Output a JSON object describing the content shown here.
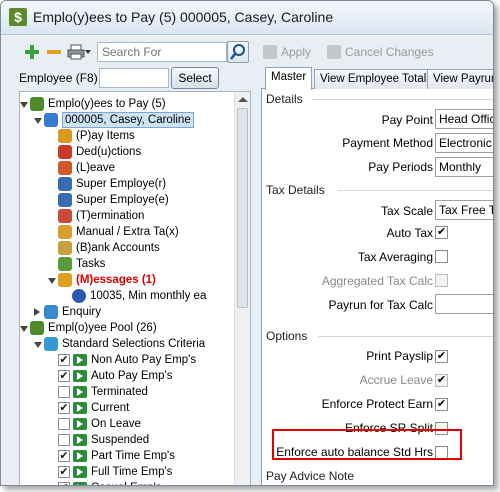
{
  "window": {
    "title": "Emplo(y)ees to Pay (5) 000005, Casey, Caroline"
  },
  "left": {
    "search_placeholder": "Search For",
    "employee_label": "Employee (F8)",
    "select_button": "Select",
    "tree": [
      {
        "label": "Emplo(y)ees to Pay (5)",
        "icon": "people-icon",
        "level": 0,
        "expander": "open",
        "type": "node"
      },
      {
        "label": "000005, Casey, Caroline",
        "icon": "person-money-icon",
        "level": 1,
        "expander": "open",
        "type": "node",
        "selected": true
      },
      {
        "label": "(P)ay Items",
        "icon": "pay-items-icon",
        "level": 2,
        "type": "node"
      },
      {
        "label": "Ded(u)ctions",
        "icon": "deductions-icon",
        "level": 2,
        "type": "node"
      },
      {
        "label": "(L)eave",
        "icon": "leave-icon",
        "level": 2,
        "type": "node"
      },
      {
        "label": "Super Employe(r)",
        "icon": "super-employer-icon",
        "level": 2,
        "type": "node"
      },
      {
        "label": "Super Employe(e)",
        "icon": "super-employee-icon",
        "level": 2,
        "type": "node"
      },
      {
        "label": "(T)ermination",
        "icon": "termination-icon",
        "level": 2,
        "type": "node"
      },
      {
        "label": "Manual / Extra Ta(x)",
        "icon": "manual-tax-icon",
        "level": 2,
        "type": "node"
      },
      {
        "label": "(B)ank Accounts",
        "icon": "bank-icon",
        "level": 2,
        "type": "node"
      },
      {
        "label": "Tasks",
        "icon": "tasks-icon",
        "level": 2,
        "type": "node"
      },
      {
        "label": "(M)essages (1)",
        "icon": "hand-icon",
        "level": 2,
        "expander": "open",
        "type": "node",
        "emphasis": true
      },
      {
        "label": "10035, Min monthly ea",
        "icon": "info-icon",
        "level": 3,
        "type": "node"
      },
      {
        "label": "Enquiry",
        "icon": "enquiry-icon",
        "level": 1,
        "expander": "closed",
        "type": "node"
      },
      {
        "label": "Empl(o)yee Pool (26)",
        "icon": "people-icon",
        "level": 0,
        "expander": "open",
        "type": "node"
      },
      {
        "label": "Standard Selections Criteria",
        "icon": "globe-icon",
        "level": 1,
        "expander": "open",
        "type": "node"
      },
      {
        "label": "Non Auto Pay Emp's",
        "checked": true,
        "level": 2,
        "type": "criteria"
      },
      {
        "label": "Auto Pay Emp's",
        "checked": true,
        "level": 2,
        "type": "criteria"
      },
      {
        "label": "Terminated",
        "checked": false,
        "level": 2,
        "type": "criteria"
      },
      {
        "label": "Current",
        "checked": true,
        "level": 2,
        "type": "criteria"
      },
      {
        "label": "On Leave",
        "checked": false,
        "level": 2,
        "type": "criteria"
      },
      {
        "label": "Suspended",
        "checked": false,
        "level": 2,
        "type": "criteria"
      },
      {
        "label": "Part Time Emp's",
        "checked": true,
        "level": 2,
        "type": "criteria"
      },
      {
        "label": "Full Time Emp's",
        "checked": true,
        "level": 2,
        "type": "criteria"
      },
      {
        "label": "Casual Emp's",
        "checked": true,
        "level": 2,
        "type": "criteria"
      }
    ]
  },
  "right": {
    "apply_label": "Apply",
    "cancel_label": "Cancel Changes",
    "tabs": [
      "Master",
      "View Employee Totals",
      "View Payrun"
    ],
    "details": {
      "title": "Details",
      "pay_point_label": "Pay Point",
      "pay_point_value": "Head Office",
      "payment_method_label": "Payment Method",
      "payment_method_value": "Electronic B",
      "pay_periods_label": "Pay Periods",
      "pay_periods_value": "Monthly"
    },
    "tax": {
      "title": "Tax Details",
      "tax_scale_label": "Tax Scale",
      "tax_scale_value": "Tax Free Th",
      "auto_tax_label": "Auto Tax",
      "auto_tax_checked": true,
      "tax_averaging_label": "Tax Averaging",
      "tax_averaging_checked": false,
      "aggregated_label": "Aggregated Tax Calc",
      "aggregated_checked": false,
      "payrun_for_tax_label": "Payrun for Tax Calc",
      "payrun_for_tax_value": ""
    },
    "options": {
      "title": "Options",
      "print_payslip_label": "Print Payslip",
      "print_payslip_checked": true,
      "accrue_leave_label": "Accrue Leave",
      "accrue_leave_checked": true,
      "enforce_protect_label": "Enforce Protect Earn",
      "enforce_protect_checked": true,
      "enforce_sr_label": "Enforce SR Split",
      "enforce_sr_checked": false,
      "enforce_auto_label": "Enforce auto balance Std Hrs",
      "enforce_auto_checked": false
    },
    "pay_advice_title": "Pay Advice Note"
  },
  "colors": {
    "highlight": "#e00000",
    "messages_text": "#e00000",
    "accent": "#2a8a3a"
  }
}
